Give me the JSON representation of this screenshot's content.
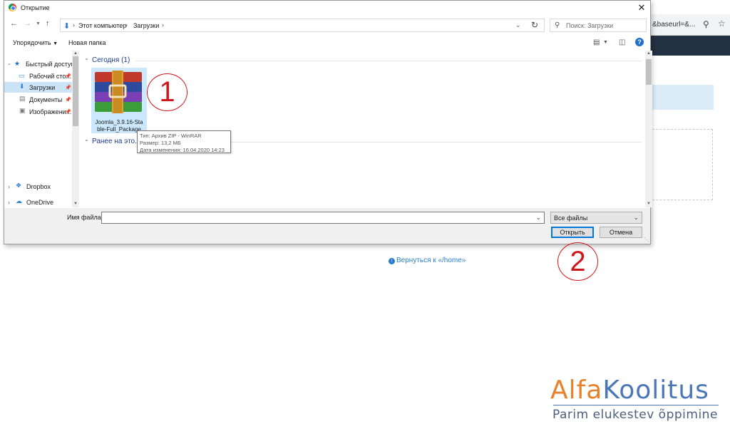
{
  "background": {
    "url_fragment": "&baseurl=&...",
    "back_link": "Вернуться к «/home»"
  },
  "dialog": {
    "title": "Открытие",
    "breadcrumbs": [
      "Этот компьютер",
      "Загрузки"
    ],
    "search_placeholder": "Поиск: Загрузки",
    "organize_label": "Упорядочить",
    "new_folder_label": "Новая папка",
    "nav": {
      "quick_access": "Быстрый доступ",
      "items": [
        "Рабочий сто...",
        "Загрузки",
        "Документы",
        "Изображени..."
      ],
      "dropbox": "Dropbox",
      "onedrive": "OneDrive"
    },
    "groups": {
      "today": "Сегодня (1)",
      "earlier": "Ранее на это..."
    },
    "file": {
      "name_line1": "Joomla_3.9.16-Sta",
      "name_line2": "ble-Full_Package"
    },
    "tooltip": {
      "type": "Тип: Архив ZIP - WinRAR",
      "size": "Размер: 13,2 МБ",
      "modified": "Дата изменения: 16.04.2020 14:23"
    },
    "filename_label": "Имя файла:",
    "filename_value": "",
    "filetype_value": "Все файлы",
    "open_label": "Открыть",
    "cancel_label": "Отмена"
  },
  "markers": [
    "1",
    "2"
  ],
  "logo": {
    "part1": "Alfa",
    "part2": "Koolitus",
    "tagline": "Parim elukestev õppimine",
    "colors": {
      "orange": "#e8822a",
      "blue": "#4b76b8"
    }
  }
}
